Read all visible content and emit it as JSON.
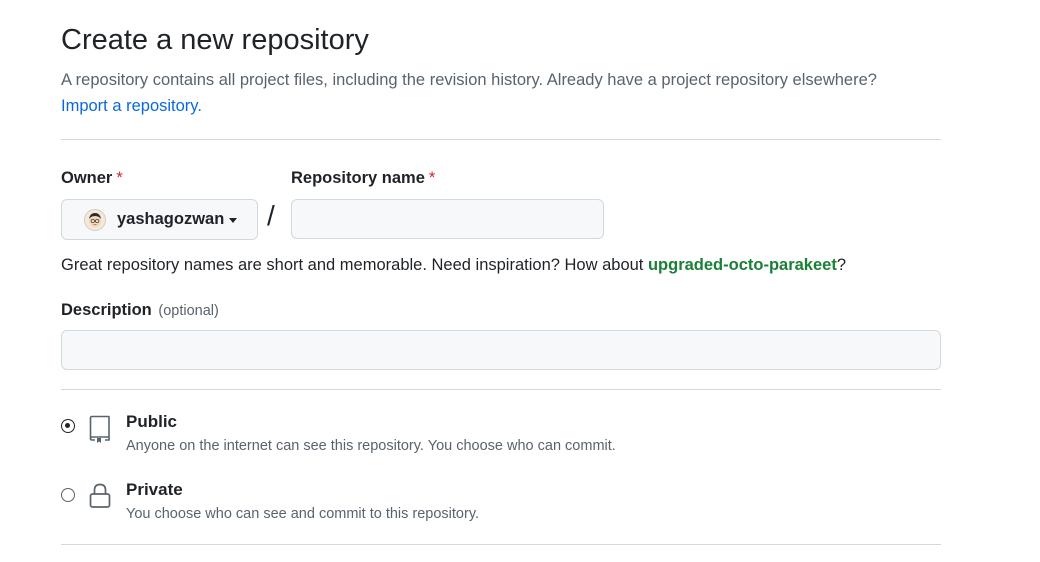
{
  "header": {
    "title": "Create a new repository",
    "subtitle": "A repository contains all project files, including the revision history. Already have a project repository elsewhere?",
    "import_link": "Import a repository."
  },
  "owner": {
    "label": "Owner",
    "required_mark": "*",
    "selected": "yashagozwan",
    "avatar_icon": "user-avatar",
    "caret_icon": "triangle-down-icon"
  },
  "separator": "/",
  "repo_name": {
    "label": "Repository name",
    "required_mark": "*",
    "value": "",
    "placeholder": ""
  },
  "name_hint": {
    "prefix": "Great repository names are short and memorable. Need inspiration? How about ",
    "suggestion": "upgraded-octo-parakeet",
    "suffix": "?"
  },
  "description": {
    "label": "Description",
    "optional_note": "(optional)",
    "value": "",
    "placeholder": ""
  },
  "visibility": {
    "options": [
      {
        "title": "Public",
        "description": "Anyone on the internet can see this repository. You choose who can commit.",
        "icon": "repo-icon",
        "checked": true
      },
      {
        "title": "Private",
        "description": "You choose who can see and commit to this repository.",
        "icon": "lock-icon",
        "checked": false
      }
    ]
  },
  "colors": {
    "link": "#0969da",
    "suggestion": "#1a7f37",
    "required": "#d1242f",
    "muted_text": "#59636e",
    "border": "#d1d9e0",
    "input_bg": "#f6f8fa"
  }
}
